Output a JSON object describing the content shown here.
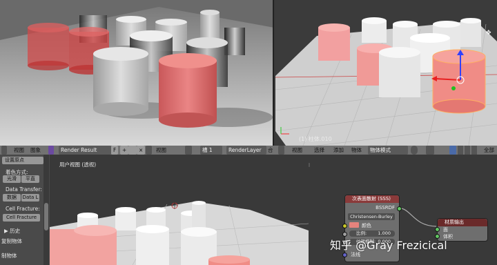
{
  "render_editor": {
    "header": {
      "view_label": "视图",
      "image_label": "图象",
      "image_name": "Render Result",
      "f_label": "F",
      "view2_label": "视图",
      "slot_label": "槽 1",
      "layer_label": "RenderLayer",
      "extra_label": "合"
    }
  },
  "viewport_top": {
    "object_label": "(1) 柱体.010",
    "header": {
      "view_label": "视图",
      "select_label": "选择",
      "add_label": "添加",
      "object_label": "物体",
      "mode_label": "物体模式",
      "global_label": "全部"
    }
  },
  "viewport_bottom": {
    "view_label": "用户视图 (透视)"
  },
  "tool_shelf": {
    "set_origin": "设置原点",
    "shading_label": "着色方式:",
    "smooth": "光滑",
    "flat": "平直",
    "data_transfer_label": "Data Transfer:",
    "data_btn": "数据",
    "data_layer_btn": "Data L",
    "cell_fracture_label": "Cell Fracture:",
    "cell_fracture_btn": "Cell Fracture",
    "history": "▶ 历史",
    "duplicate": "复制物体",
    "duplicate2": "制物体"
  },
  "node_editor": {
    "sss_node": {
      "title": "次表面散射 (SSS)",
      "output": "BSSRDF",
      "falloff": "Christensen-Burley",
      "color_label": "颜色",
      "scale_label": "比例:",
      "scale_value": "1.000",
      "radius_label": "纹理模糊:",
      "radius_value": "0.000",
      "normal_label": "法线"
    },
    "output_node": {
      "title": "材质输出",
      "surface": "面",
      "volume": "体积"
    }
  },
  "watermark": "知乎 @Gray Frezicical",
  "colors": {
    "node_header": "#8a3a3a",
    "output_header": "#6a2a2a",
    "salmon": "#e6837d",
    "socket_green": "#63c763",
    "socket_purple": "#6363c7"
  }
}
